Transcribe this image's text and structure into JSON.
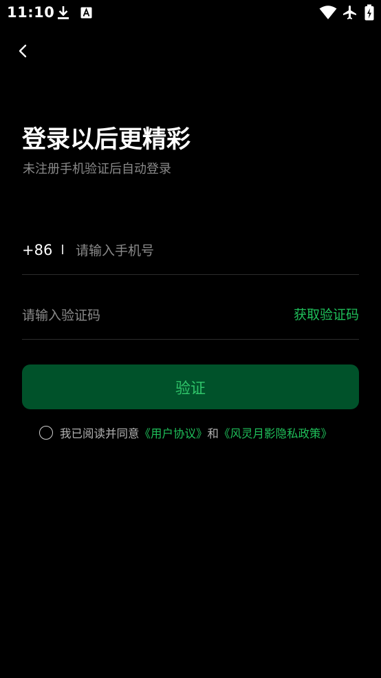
{
  "status_bar": {
    "time": "11:10",
    "icons": [
      "download-icon",
      "font-a-icon",
      "wifi-icon",
      "airplane-mode-icon",
      "battery-icon"
    ]
  },
  "header": {
    "back_icon": "chevron-left-icon"
  },
  "login": {
    "title": "登录以后更精彩",
    "subtitle": "未注册手机验证后自动登录",
    "country_code": "+86",
    "phone_placeholder": "请输入手机号",
    "phone_value": "",
    "code_placeholder": "请输入验证码",
    "code_value": "",
    "get_code_label": "获取验证码",
    "verify_label": "验证"
  },
  "agreement": {
    "checked": false,
    "prefix": "我已阅读并同意",
    "user_agreement": "《用户协议》",
    "conjunction": "和",
    "privacy_policy": "《风灵月影隐私政策》"
  },
  "colors": {
    "background": "#000000",
    "accent_green": "#1fbf5a",
    "button_bg": "#00522a",
    "muted_text": "#8a8a8a"
  }
}
